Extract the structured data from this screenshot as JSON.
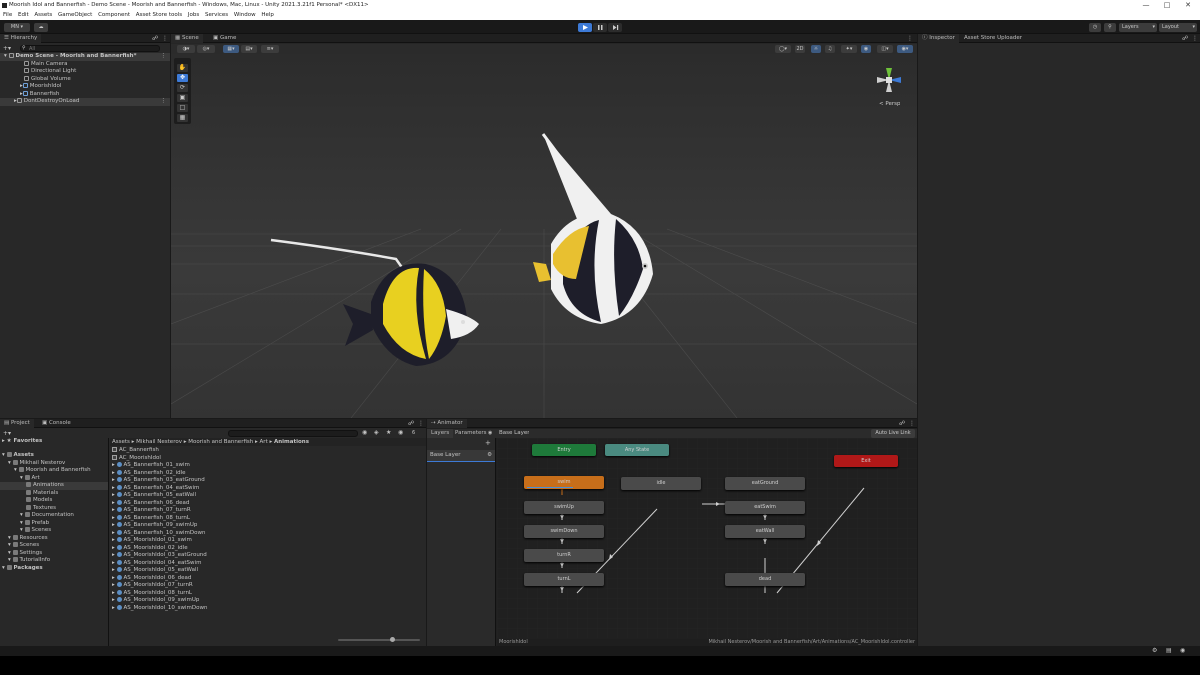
{
  "window": {
    "title": "Moorish Idol and Bannerfish - Demo Scene - Moorish and Bannerfish - Windows, Mac, Linux - Unity 2021.3.21f1 Personal* <DX11>"
  },
  "menu": [
    "File",
    "Edit",
    "Assets",
    "GameObject",
    "Component",
    "Asset Store tools",
    "Jobs",
    "Services",
    "Window",
    "Help"
  ],
  "toolbar": {
    "account": "MN",
    "layers": "Layers",
    "layout": "Layout"
  },
  "hierarchy": {
    "tab": "Hierarchy",
    "search_placeholder": "All",
    "items": [
      {
        "label": "Demo Scene - Moorish and Bannerfish*"
      },
      {
        "label": "Main Camera"
      },
      {
        "label": "Directional Light"
      },
      {
        "label": "Global Volume"
      },
      {
        "label": "MoorishIdol"
      },
      {
        "label": "Bannerfish"
      },
      {
        "label": "DontDestroyOnLoad"
      }
    ]
  },
  "scene": {
    "tabs": [
      "Scene",
      "Game"
    ],
    "persp_label": "< Persp"
  },
  "inspector": {
    "tabs": [
      "Inspector",
      "Asset Store Uploader"
    ]
  },
  "project": {
    "tabs": [
      "Project",
      "Console"
    ],
    "count": "6",
    "favorites": "Favorites",
    "tree": [
      {
        "label": "Assets",
        "depth": 0,
        "bold": true
      },
      {
        "label": "Mikhail Nesterov",
        "depth": 1
      },
      {
        "label": "Moorish and Bannerfish",
        "depth": 2
      },
      {
        "label": "Art",
        "depth": 3
      },
      {
        "label": "Animations",
        "depth": 4,
        "selected": true
      },
      {
        "label": "Materials",
        "depth": 4
      },
      {
        "label": "Models",
        "depth": 4
      },
      {
        "label": "Textures",
        "depth": 4
      },
      {
        "label": "Documentation",
        "depth": 3
      },
      {
        "label": "Prefab",
        "depth": 3
      },
      {
        "label": "Scenes",
        "depth": 3
      },
      {
        "label": "Resources",
        "depth": 1
      },
      {
        "label": "Scenes",
        "depth": 1
      },
      {
        "label": "Settings",
        "depth": 1
      },
      {
        "label": "TutorialInfo",
        "depth": 1
      },
      {
        "label": "Packages",
        "depth": 0,
        "bold": true
      }
    ],
    "breadcrumb": [
      "Assets",
      "Mikhail Nesterov",
      "Moorish and Bannerfish",
      "Art",
      "Animations"
    ],
    "files": [
      {
        "label": "AC_Bannerfish",
        "kind": "controller"
      },
      {
        "label": "AC_MoorishIdol",
        "kind": "controller"
      },
      {
        "label": "AS_Bannerfish_01_swim",
        "kind": "anim"
      },
      {
        "label": "AS_Bannerfish_02_idle",
        "kind": "anim"
      },
      {
        "label": "AS_Bannerfish_03_eatGround",
        "kind": "anim"
      },
      {
        "label": "AS_Bannerfish_04_eatSwim",
        "kind": "anim"
      },
      {
        "label": "AS_Bannerfish_05_eatWall",
        "kind": "anim"
      },
      {
        "label": "AS_Bannerfish_06_dead",
        "kind": "anim"
      },
      {
        "label": "AS_Bannerfish_07_turnR",
        "kind": "anim"
      },
      {
        "label": "AS_Bannerfish_08_turnL",
        "kind": "anim"
      },
      {
        "label": "AS_Bannerfish_09_swimUp",
        "kind": "anim"
      },
      {
        "label": "AS_Bannerfish_10_swimDown",
        "kind": "anim"
      },
      {
        "label": "AS_MoorishIdol_01_swim",
        "kind": "anim"
      },
      {
        "label": "AS_MoorishIdol_02_idle",
        "kind": "anim"
      },
      {
        "label": "AS_MoorishIdol_03_eatGround",
        "kind": "anim"
      },
      {
        "label": "AS_MoorishIdol_04_eatSwim",
        "kind": "anim"
      },
      {
        "label": "AS_MoorishIdol_05_eatWall",
        "kind": "anim"
      },
      {
        "label": "AS_MoorishIdol_06_dead",
        "kind": "anim"
      },
      {
        "label": "AS_MoorishIdol_07_turnR",
        "kind": "anim"
      },
      {
        "label": "AS_MoorishIdol_08_turnL",
        "kind": "anim"
      },
      {
        "label": "AS_MoorishIdol_09_swimUp",
        "kind": "anim"
      },
      {
        "label": "AS_MoorishIdol_10_swimDown",
        "kind": "anim"
      }
    ]
  },
  "animator": {
    "tab": "Animator",
    "subtabs": [
      "Layers",
      "Parameters"
    ],
    "breadcrumb": "Base Layer",
    "auto_live_link": "Auto Live Link",
    "layer_name": "Base Layer",
    "footer_left": "MoorishIdol",
    "footer_right": "Mikhail Nesterov/Moorish and Bannerfish/Art/Animations/AC_MoorishIdol.controller",
    "states": {
      "entry": "Entry",
      "any_state": "Any State",
      "exit": "Exit",
      "swim": "swim",
      "swim_up": "swimUp",
      "swim_down": "swimDown",
      "turn_r": "turnR",
      "turn_l": "turnL",
      "idle": "idle",
      "eat_ground": "eatGround",
      "eat_swim": "eatSwim",
      "eat_wall": "eatWall",
      "dead": "dead"
    }
  },
  "colors": {
    "entry": "#1e7a3a",
    "any_state": "#4a8a80",
    "exit": "#b01818",
    "default_state": "#c76e1a",
    "accent": "#3d7ad6"
  }
}
